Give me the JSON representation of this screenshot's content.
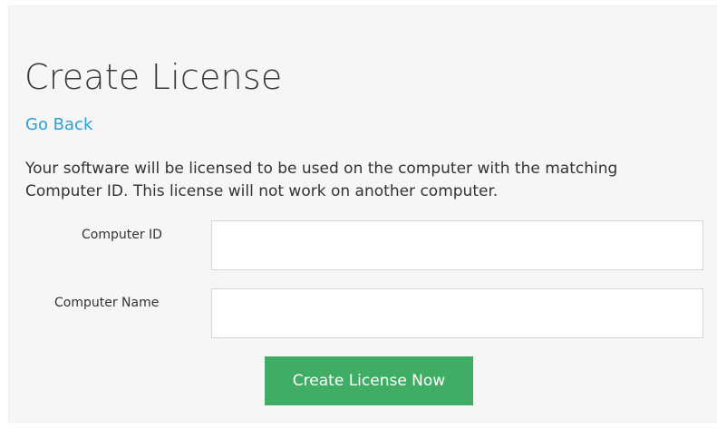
{
  "page": {
    "title": "Create License",
    "back_link": "Go Back",
    "intro": "Your software will be licensed to be used on the computer with the matching Computer ID. This license will not work on another computer."
  },
  "form": {
    "computer_id": {
      "label": "Computer ID",
      "value": "",
      "placeholder": ""
    },
    "computer_name": {
      "label": "Computer Name",
      "value": "",
      "placeholder": ""
    },
    "submit_label": "Create License Now"
  },
  "colors": {
    "link": "#2a9fd6",
    "button": "#3fae64",
    "panel_background": "#f6f6f6"
  }
}
